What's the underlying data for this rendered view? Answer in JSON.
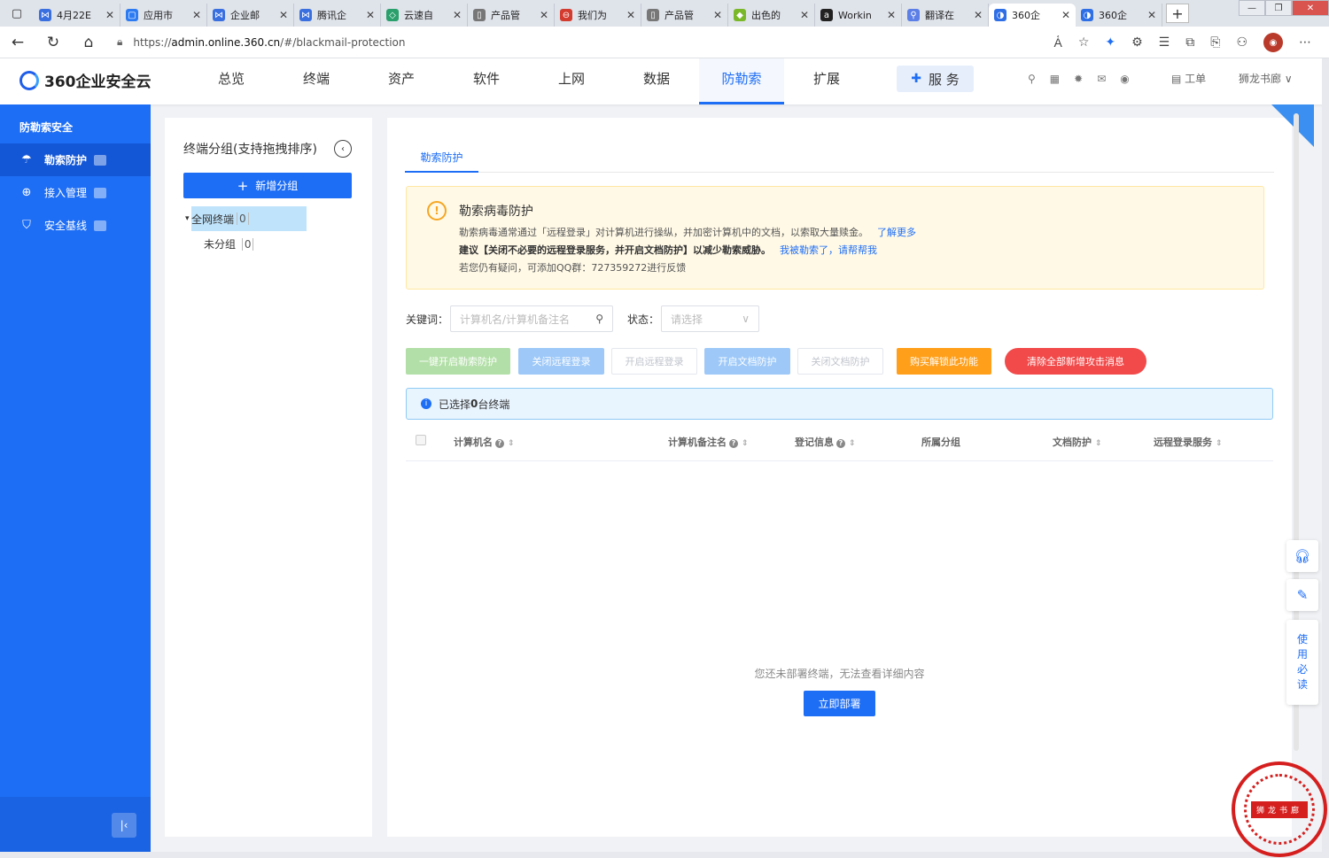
{
  "browser": {
    "tabs": [
      {
        "title": "4月22E",
        "color": "#3a6fe0",
        "glyph": "⋈"
      },
      {
        "title": "应用市",
        "color": "#2c7bf2",
        "glyph": "▢"
      },
      {
        "title": "企业邮",
        "color": "#3a6fe0",
        "glyph": "⋈"
      },
      {
        "title": "腾讯企",
        "color": "#3a6fe0",
        "glyph": "⋈"
      },
      {
        "title": "云速自",
        "color": "#2aa06c",
        "glyph": "◇"
      },
      {
        "title": "产品管",
        "color": "#777777",
        "glyph": "▯"
      },
      {
        "title": "我们为",
        "color": "#d33b2f",
        "glyph": "⊖"
      },
      {
        "title": "产品管",
        "color": "#777777",
        "glyph": "▯"
      },
      {
        "title": "出色的",
        "color": "#7ab829",
        "glyph": "◆"
      },
      {
        "title": "Workin",
        "color": "#222222",
        "glyph": "a"
      },
      {
        "title": "翻译在",
        "color": "#5b7fe6",
        "glyph": "⚲"
      },
      {
        "title": "360企",
        "color": "#2f6fe6",
        "glyph": "◑",
        "active": true
      },
      {
        "title": "360企",
        "color": "#2f6fe6",
        "glyph": "◑"
      }
    ],
    "url_prefix": "https://",
    "url_host": "admin.online.360.cn",
    "url_path": "/#/blackmail-protection"
  },
  "header": {
    "logo_text": "360企业安全云",
    "nav": [
      "总览",
      "终端",
      "资产",
      "软件",
      "上网",
      "数据",
      "防勒索",
      "扩展"
    ],
    "active_nav": "防勒索",
    "service_label": "服 务",
    "work_order_label": "工单",
    "username": "狮龙书廊"
  },
  "sidebar": {
    "section_title": "防勒索安全",
    "items": [
      {
        "label": "勒索防护",
        "icon": "umbrella-icon"
      },
      {
        "label": "接入管理",
        "icon": "download-icon"
      },
      {
        "label": "安全基线",
        "icon": "shield-icon"
      }
    ]
  },
  "groups": {
    "title": "终端分组(支持拖拽排序)",
    "add_label": "新增分组",
    "all_label": "全网终端",
    "all_count": "0",
    "ungrouped_label": "未分组",
    "ungrouped_count": "0"
  },
  "main": {
    "tab": "勒索防护",
    "alert": {
      "title": "勒索病毒防护",
      "line1": "勒索病毒通常通过「远程登录」对计算机进行操纵，并加密计算机中的文档，以索取大量赎金。",
      "line1_link": "了解更多",
      "line2": "建议【关闭不必要的远程登录服务，并开启文档防护】以减少勒索威胁。",
      "line2_link": "我被勒索了，请帮帮我",
      "line3": "若您仍有疑问，可添加QQ群：727359272进行反馈"
    },
    "filter": {
      "keyword_label": "关键词：",
      "keyword_placeholder": "计算机名/计算机备注名",
      "status_label": "状态：",
      "status_placeholder": "请选择"
    },
    "buttons": [
      "一键开启勒索防护",
      "关闭远程登录",
      "开启远程登录",
      "开启文档防护",
      "关闭文档防护",
      "购买解锁此功能",
      "清除全部新增攻击消息"
    ],
    "selected_prefix": "已选择 ",
    "selected_count": "0",
    "selected_suffix": " 台终端",
    "columns": [
      "计算机名",
      "计算机备注名",
      "登记信息",
      "所属分组",
      "文档防护",
      "远程登录服务"
    ],
    "empty_text": "您还未部署终端，无法查看详细内容",
    "deploy_label": "立即部署"
  },
  "float_tools": {
    "read_label": [
      "使",
      "用",
      "必",
      "读"
    ]
  },
  "stamp_text": "狮龙书廊",
  "colors": {
    "primary": "#1e6ef5",
    "sidebar": "#1e6ef5",
    "warning": "#f5a623",
    "orange": "#ff9f1a",
    "danger": "#f24a4a"
  }
}
